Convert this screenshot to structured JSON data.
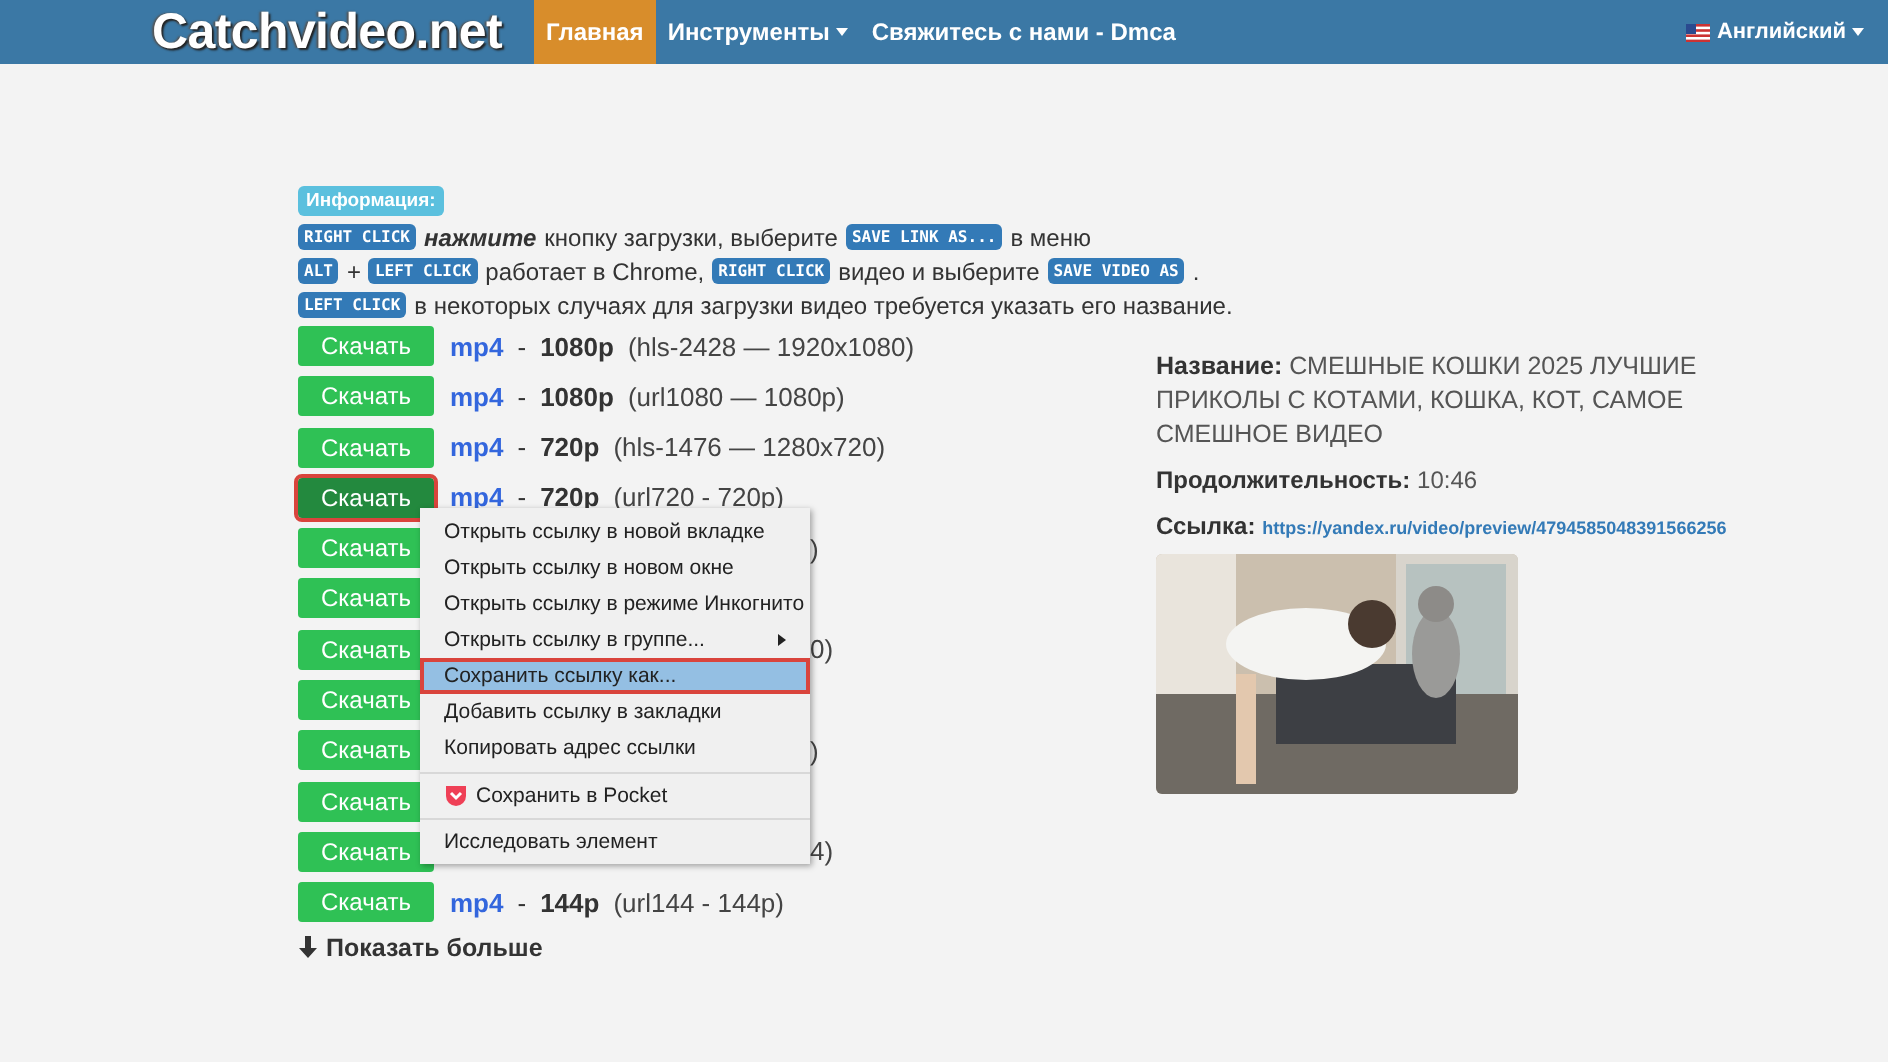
{
  "nav": {
    "logo": "Catchvideo.net",
    "items": [
      {
        "label": "Главная",
        "selected": true,
        "dropdown": false
      },
      {
        "label": "Инструменты",
        "selected": false,
        "dropdown": true
      },
      {
        "label": "Свяжитесь с нами - Dmca",
        "selected": false,
        "dropdown": false
      }
    ],
    "language": "Английский"
  },
  "info": {
    "badge": "Информация:",
    "lines": [
      [
        {
          "kind": "key",
          "text": "RIGHT CLICK"
        },
        {
          "kind": "emph",
          "text": "нажмите"
        },
        {
          "kind": "text",
          "text": "кнопку загрузки, выберите"
        },
        {
          "kind": "key",
          "text": "SAVE LINK AS..."
        },
        {
          "kind": "text",
          "text": "в меню"
        }
      ],
      [
        {
          "kind": "key",
          "text": "ALT"
        },
        {
          "kind": "text",
          "text": "+"
        },
        {
          "kind": "key",
          "text": "LEFT CLICK"
        },
        {
          "kind": "text",
          "text": "работает в Chrome,"
        },
        {
          "kind": "key",
          "text": "RIGHT CLICK"
        },
        {
          "kind": "text",
          "text": "видео и выберите"
        },
        {
          "kind": "key",
          "text": "SAVE VIDEO AS"
        },
        {
          "kind": "text",
          "text": "."
        }
      ],
      [
        {
          "kind": "key",
          "text": "LEFT CLICK"
        },
        {
          "kind": "text",
          "text": "в некоторых случаях для загрузки видео требуется указать его название."
        }
      ]
    ]
  },
  "formats": [
    {
      "button": "Скачать",
      "highlighted": false,
      "ext": "mp4",
      "sep": "-",
      "quality": "1080p",
      "detail": "(hls-2428 — 1920x1080)"
    },
    {
      "button": "Скачать",
      "highlighted": false,
      "ext": "mp4",
      "sep": "-",
      "quality": "1080p",
      "detail": "(url1080 — 1080p)"
    },
    {
      "button": "Скачать",
      "highlighted": false,
      "ext": "mp4",
      "sep": "-",
      "quality": "720p",
      "detail": "(hls-1476 — 1280x720)"
    },
    {
      "button": "Скачать",
      "highlighted": true,
      "ext": "mp4",
      "sep": "-",
      "quality": "720p",
      "detail": "(url720 - 720p)"
    },
    {
      "button": "Скачать",
      "highlighted": false,
      "tail": ")"
    },
    {
      "button": "Скачать",
      "highlighted": false
    },
    {
      "button": "Скачать",
      "highlighted": false,
      "tail": "0)"
    },
    {
      "button": "Скачать",
      "highlighted": false
    },
    {
      "button": "Скачать",
      "highlighted": false,
      "tail": ")"
    },
    {
      "button": "Скачать",
      "highlighted": false
    },
    {
      "button": "Скачать",
      "highlighted": false,
      "tail": "4)"
    },
    {
      "button": "Скачать",
      "highlighted": false,
      "ext": "mp4",
      "sep": "-",
      "quality": "144p",
      "detail": "(url144 - 144p)"
    }
  ],
  "show_more": "Показать больше",
  "context_menu": [
    {
      "kind": "item",
      "label": "Открыть ссылку в новой вкладке",
      "selected": false,
      "submenu": false,
      "separator_before": false
    },
    {
      "kind": "item",
      "label": "Открыть ссылку в новом окне",
      "selected": false,
      "submenu": false,
      "separator_before": false
    },
    {
      "kind": "item",
      "label": "Открыть ссылку в режиме Инкогнито",
      "selected": false,
      "submenu": false,
      "separator_before": false
    },
    {
      "kind": "item",
      "label": "Открыть ссылку в группе...",
      "selected": false,
      "submenu": true,
      "separator_before": false
    },
    {
      "kind": "item",
      "label": "Сохранить ссылку как...",
      "selected": true,
      "submenu": false,
      "separator_before": false
    },
    {
      "kind": "item",
      "label": "Добавить ссылку в закладки",
      "selected": false,
      "submenu": false,
      "separator_before": false
    },
    {
      "kind": "item",
      "label": "Копировать адрес ссылки",
      "selected": false,
      "submenu": false,
      "separator_before": false
    },
    {
      "kind": "pocket",
      "label": "Сохранить в Pocket",
      "selected": false,
      "submenu": false,
      "separator_before": true
    },
    {
      "kind": "item",
      "label": "Исследовать элемент",
      "selected": false,
      "submenu": false,
      "separator_before": true
    }
  ],
  "video": {
    "title_label": "Название:",
    "title": "СМЕШНЫЕ КОШКИ 2025 ЛУЧШИЕ ПРИКОЛЫ С КОТАМИ, КОШКА, КОТ, САМОЕ СМЕШНОЕ ВИДЕО",
    "duration_label": "Продолжительность:",
    "duration": "10:46",
    "link_label": "Ссылка:",
    "link": "https://yandex.ru/video/preview/4794585048391566256"
  }
}
